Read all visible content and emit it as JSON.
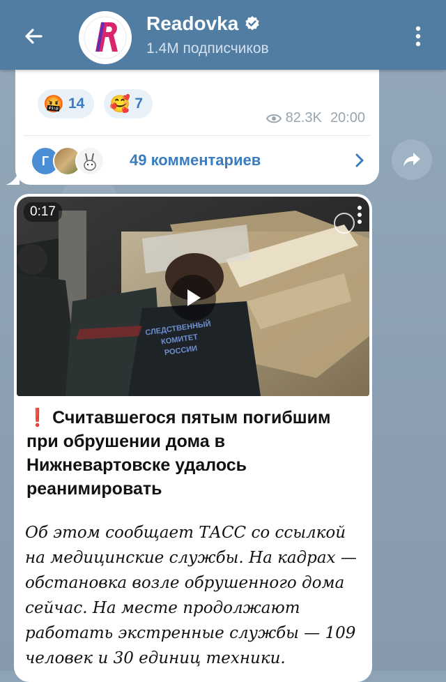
{
  "channel": {
    "name": "Readovka",
    "subscribers": "1.4M подписчиков",
    "avatar_letter": "R",
    "verified": true
  },
  "colors": {
    "header": "#527da3",
    "accent": "#3a7cbf",
    "reaction_bg": "#e8f0f8",
    "alert_red": "#e02020"
  },
  "previous_post": {
    "reactions": [
      {
        "icon": "angry-cursing-emoji",
        "glyph": "🤬",
        "count": "14"
      },
      {
        "icon": "smiling-hearts-emoji",
        "glyph": "🥰",
        "count": "7"
      }
    ],
    "views": "82.3K",
    "time": "20:00",
    "comments_avatar_letter": "Г",
    "comments_label": "49 комментариев"
  },
  "post": {
    "video_duration": "0:17",
    "headline_mark": "❗",
    "headline": "Считавшегося пятым погибшим при обрушении дома в Нижневартовске удалось реанимировать",
    "body": "Об этом сообщает ТАСС со ссылкой на медицинские службы. На кадрах — обстановка возле обрушенного дома сейчас. На месте продолжают работать экстренные службы — 109 человек и 30 единиц техники."
  }
}
